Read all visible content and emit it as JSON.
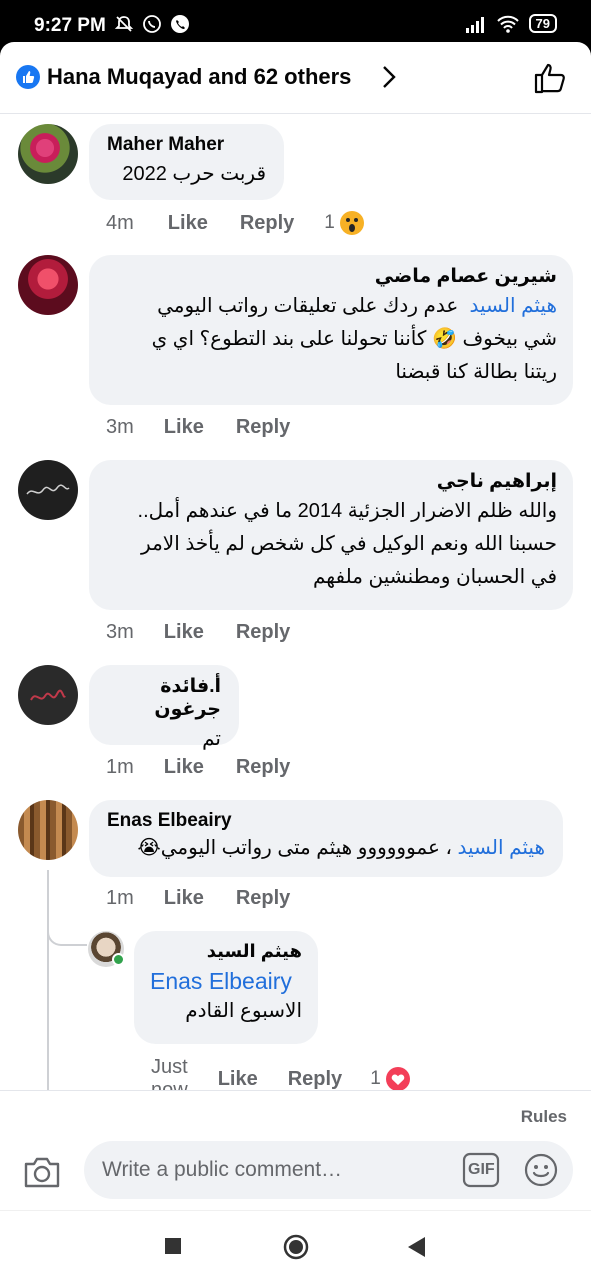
{
  "status_bar": {
    "time": "9:27 PM",
    "battery": "79"
  },
  "header": {
    "title": "Hana Muqayad and 62 others"
  },
  "comments": [
    {
      "author": "Maher Maher",
      "text": "قربت حرب 2022",
      "time": "4m",
      "like": "Like",
      "reply": "Reply",
      "reactions": "1"
    },
    {
      "author": "شيرين عصام ماضي",
      "tag": "هيثم السيد",
      "text1": "عدم ردك على تعليقات رواتب اليومي",
      "text2": "شي بيخوف 🤣 كأننا تحولنا على بند التطوع؟ اي ي",
      "text3": "ريتنا بطالة كنا قبضنا",
      "time": "3m",
      "like": "Like",
      "reply": "Reply"
    },
    {
      "author": "إبراهيم ناجي",
      "text1": "والله ظلم الاضرار الجزئية 2014 ما في عندهم أمل..",
      "text2": "حسبنا الله ونعم الوكيل في كل شخص لم يأخذ الامر",
      "text3": "في الحسبان ومطنشين ملفهم",
      "time": "3m",
      "like": "Like",
      "reply": "Reply"
    },
    {
      "author": "أ.فائدة جرغون",
      "text": "تم",
      "time": "1m",
      "like": "Like",
      "reply": "Reply"
    },
    {
      "author": "Enas Elbeairy",
      "tag": "هيثم السيد",
      "text": "، عموووووو هيثم متى رواتب اليومي😭",
      "time": "1m",
      "like": "Like",
      "reply": "Reply"
    }
  ],
  "reply": {
    "author": "هيثم السيد",
    "tag": "Enas Elbeairy",
    "text": "الاسبوع القادم",
    "time": "Just now",
    "like": "Like",
    "reply": "Reply",
    "reactions": "1"
  },
  "composer": {
    "rules": "Rules",
    "placeholder": "Write a public comment…",
    "gif": "GIF"
  },
  "colors": {
    "accent": "#1877f2",
    "link": "#216fdb",
    "bubble": "#f0f2f5",
    "muted": "#65676b",
    "love": "#f33e58"
  }
}
